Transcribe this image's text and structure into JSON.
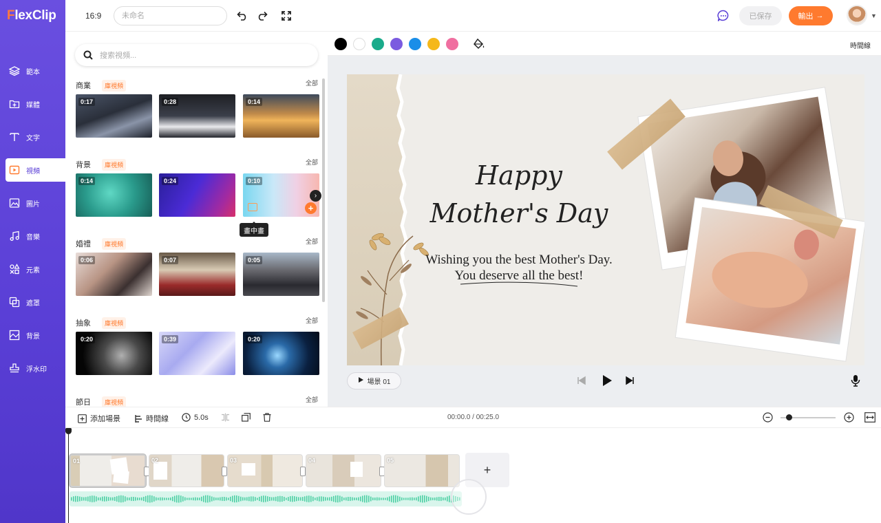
{
  "app": {
    "logo": "FlexClip",
    "ratio": "16:9",
    "title_placeholder": "未命名",
    "saved": "已保存",
    "export": "輸出"
  },
  "nav": [
    {
      "label": "範本",
      "icon": "layers-icon"
    },
    {
      "label": "媒體",
      "icon": "folder-plus-icon"
    },
    {
      "label": "文字",
      "icon": "text-icon"
    },
    {
      "label": "視頻",
      "icon": "video-icon"
    },
    {
      "label": "圖片",
      "icon": "image-icon"
    },
    {
      "label": "音樂",
      "icon": "music-icon"
    },
    {
      "label": "元素",
      "icon": "elements-icon"
    },
    {
      "label": "遮罩",
      "icon": "overlay-icon"
    },
    {
      "label": "背景",
      "icon": "background-icon"
    },
    {
      "label": "浮水印",
      "icon": "watermark-icon"
    }
  ],
  "panel": {
    "search_placeholder": "搜索視頻...",
    "categories": [
      {
        "name": "商業",
        "tag": "庫視頻",
        "all": "全部",
        "durations": [
          "0:17",
          "0:28",
          "0:14"
        ]
      },
      {
        "name": "背景",
        "tag": "庫視頻",
        "all": "全部",
        "durations": [
          "0:14",
          "0:24",
          "0:10"
        ]
      },
      {
        "name": "婚禮",
        "tag": "庫視頻",
        "all": "全部",
        "durations": [
          "0:06",
          "0:07",
          "0:05"
        ]
      },
      {
        "name": "抽象",
        "tag": "庫視頻",
        "all": "全部",
        "durations": [
          "0:20",
          "0:39",
          "0:20"
        ]
      },
      {
        "name": "節日",
        "tag": "庫視頻",
        "all": "全部",
        "durations": []
      }
    ],
    "tooltip": "畫中畫"
  },
  "colorbar": {
    "swatches": [
      "#000000",
      "#ffffff",
      "#1aab8b",
      "#7b5be0",
      "#1a8ee8",
      "#f5b81a",
      "#f06fa0"
    ],
    "timeline_label": "時間線"
  },
  "canvas": {
    "line1": "Happy",
    "line2": "Mother's Day",
    "wish": "Wishing you the best Mother's Day.",
    "deserve": "You deserve all the best!"
  },
  "stage": {
    "scene_label": "場景 01"
  },
  "timeline": {
    "add_scene": "添加場景",
    "timeline": "時間線",
    "duration": "5.0s",
    "time": "00:00.0 / 00:25.0",
    "clips": [
      "01",
      "02",
      "03",
      "04",
      "05"
    ]
  }
}
